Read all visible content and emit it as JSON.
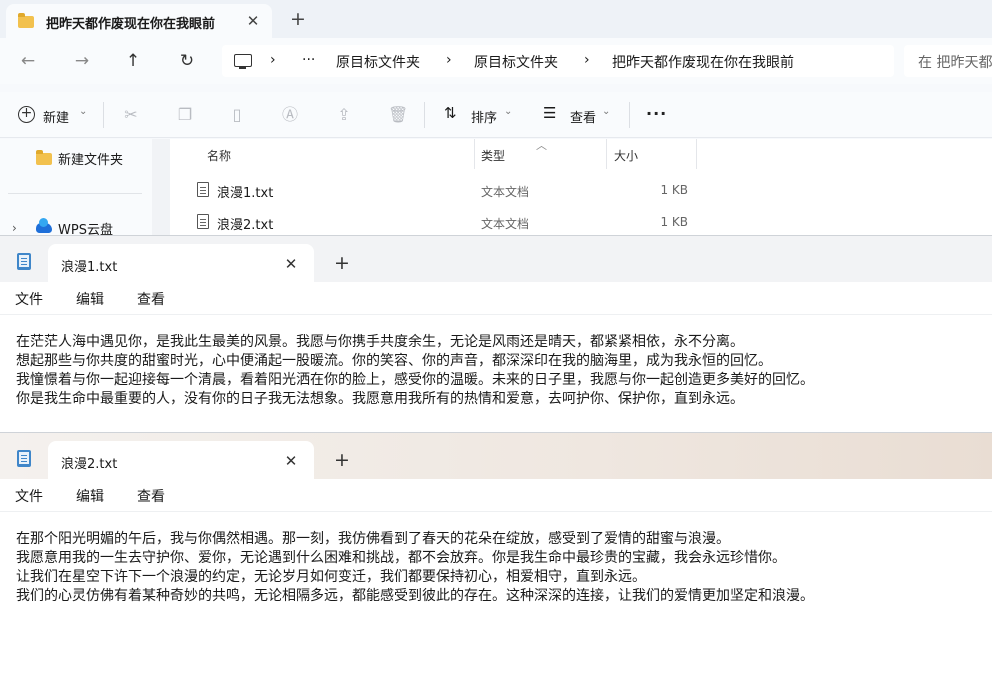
{
  "explorer": {
    "tab_title": "把昨天都作废现在你在我眼前",
    "close_glyph": "✕",
    "newtab_glyph": "+",
    "nav": {
      "back": "←",
      "forward": "→",
      "up": "↑",
      "refresh": "↻"
    },
    "breadcrumb": [
      "›",
      "···",
      "原目标文件夹",
      "›",
      "原目标文件夹",
      "›",
      "把昨天都作废现在你在我眼前"
    ],
    "search_placeholder": "在 把昨天都",
    "toolbar": {
      "new_label": "新建",
      "sort_label": "排序",
      "view_label": "查看",
      "more": "···",
      "icons": [
        "cut-icon",
        "copy-icon",
        "paste-icon",
        "rename-icon",
        "share-icon",
        "delete-icon"
      ]
    },
    "sidebar": {
      "new_folder": "新建文件夹",
      "wps_cloud": "WPS云盘"
    },
    "columns": {
      "name": "名称",
      "type": "类型",
      "size": "大小"
    },
    "files": [
      {
        "name": "浪漫1.txt",
        "type": "文本文档",
        "size": "1 KB"
      },
      {
        "name": "浪漫2.txt",
        "type": "文本文档",
        "size": "1 KB"
      }
    ]
  },
  "notepad1": {
    "tab_title": "浪漫1.txt",
    "close_glyph": "✕",
    "newtab_glyph": "+",
    "menu": {
      "file": "文件",
      "edit": "编辑",
      "view": "查看"
    },
    "lines": [
      "在茫茫人海中遇见你，是我此生最美的风景。我愿与你携手共度余生，无论是风雨还是晴天，都紧紧相依，永不分离。",
      "想起那些与你共度的甜蜜时光，心中便涌起一股暖流。你的笑容、你的声音，都深深印在我的脑海里，成为我永恒的回忆。",
      "我憧憬着与你一起迎接每一个清晨，看着阳光洒在你的脸上，感受你的温暖。未来的日子里，我愿与你一起创造更多美好的回忆。",
      "你是我生命中最重要的人，没有你的日子我无法想象。我愿意用我所有的热情和爱意，去呵护你、保护你，直到永远。"
    ]
  },
  "notepad2": {
    "tab_title": "浪漫2.txt",
    "close_glyph": "✕",
    "newtab_glyph": "+",
    "menu": {
      "file": "文件",
      "edit": "编辑",
      "view": "查看"
    },
    "lines": [
      "在那个阳光明媚的午后，我与你偶然相遇。那一刻，我仿佛看到了春天的花朵在绽放，感受到了爱情的甜蜜与浪漫。",
      "我愿意用我的一生去守护你、爱你，无论遇到什么困难和挑战，都不会放弃。你是我生命中最珍贵的宝藏，我会永远珍惜你。",
      "让我们在星空下许下一个浪漫的约定，无论岁月如何变迁，我们都要保持初心，相爱相守，直到永远。",
      "我们的心灵仿佛有着某种奇妙的共鸣，无论相隔多远，都能感受到彼此的存在。这种深深的连接，让我们的爱情更加坚定和浪漫。"
    ]
  }
}
